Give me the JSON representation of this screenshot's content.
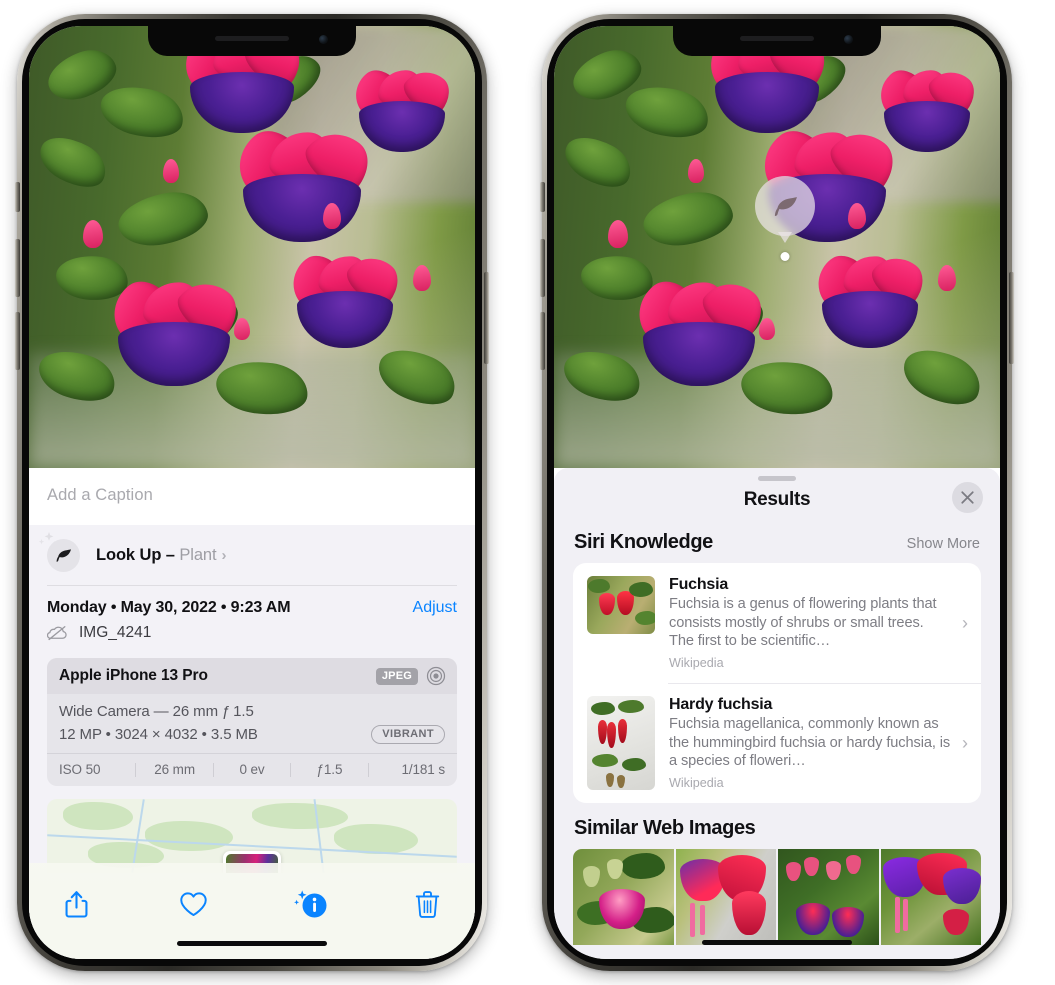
{
  "left_phone": {
    "name": "photos-detail-screen",
    "caption": {
      "placeholder": "Add a Caption",
      "value": ""
    },
    "lookup_row": {
      "icon": "leaf-icon",
      "label": "Look Up – ",
      "subject": "Plant",
      "chevron": "›"
    },
    "meta": {
      "date": "Monday • May 30, 2022 • 9:23 AM",
      "adjust_label": "Adjust",
      "cloud_icon": "icloud-slash-icon",
      "filename": "IMG_4241"
    },
    "camera_card": {
      "model": "Apple iPhone 13 Pro",
      "format_badge": "JPEG",
      "aperture_icon": "camera-aperture-icon",
      "lens_line": "Wide Camera — 26 mm ƒ 1.5",
      "size_line": "12 MP • 3024 × 4032 • 3.5 MB",
      "style_badge": "VIBRANT",
      "exif": [
        "ISO 50",
        "26 mm",
        "0 ev",
        "ƒ1.5",
        "1/181 s"
      ]
    },
    "toolbar": {
      "share_icon": "share-icon",
      "favorite_icon": "heart-icon",
      "info_icon": "info-sparkle-icon",
      "delete_icon": "trash-icon"
    }
  },
  "right_phone": {
    "name": "visual-look-up-results-screen",
    "badge": {
      "icon": "leaf-icon",
      "label": "visual-look-up-badge"
    },
    "sheet": {
      "title": "Results",
      "close_icon": "close-icon",
      "siri_knowledge": {
        "heading": "Siri Knowledge",
        "show_more": "Show More",
        "items": [
          {
            "title": "Fuchsia",
            "description": "Fuchsia is a genus of flowering plants that consists mostly of shrubs or small trees. The first to be scientific…",
            "source": "Wikipedia",
            "chevron": "›"
          },
          {
            "title": "Hardy fuchsia",
            "description": "Fuchsia magellanica, commonly known as the hummingbird fuchsia or hardy fuchsia, is a species of floweri…",
            "source": "Wikipedia",
            "chevron": "›"
          }
        ]
      },
      "similar_web_images": {
        "heading": "Similar Web Images",
        "count": 4
      }
    }
  },
  "colors": {
    "accent_blue": "#0a84ff",
    "sheet_gray": "#f1f0f5",
    "card_white": "#ffffff",
    "secondary_text": "#7d7d84"
  }
}
